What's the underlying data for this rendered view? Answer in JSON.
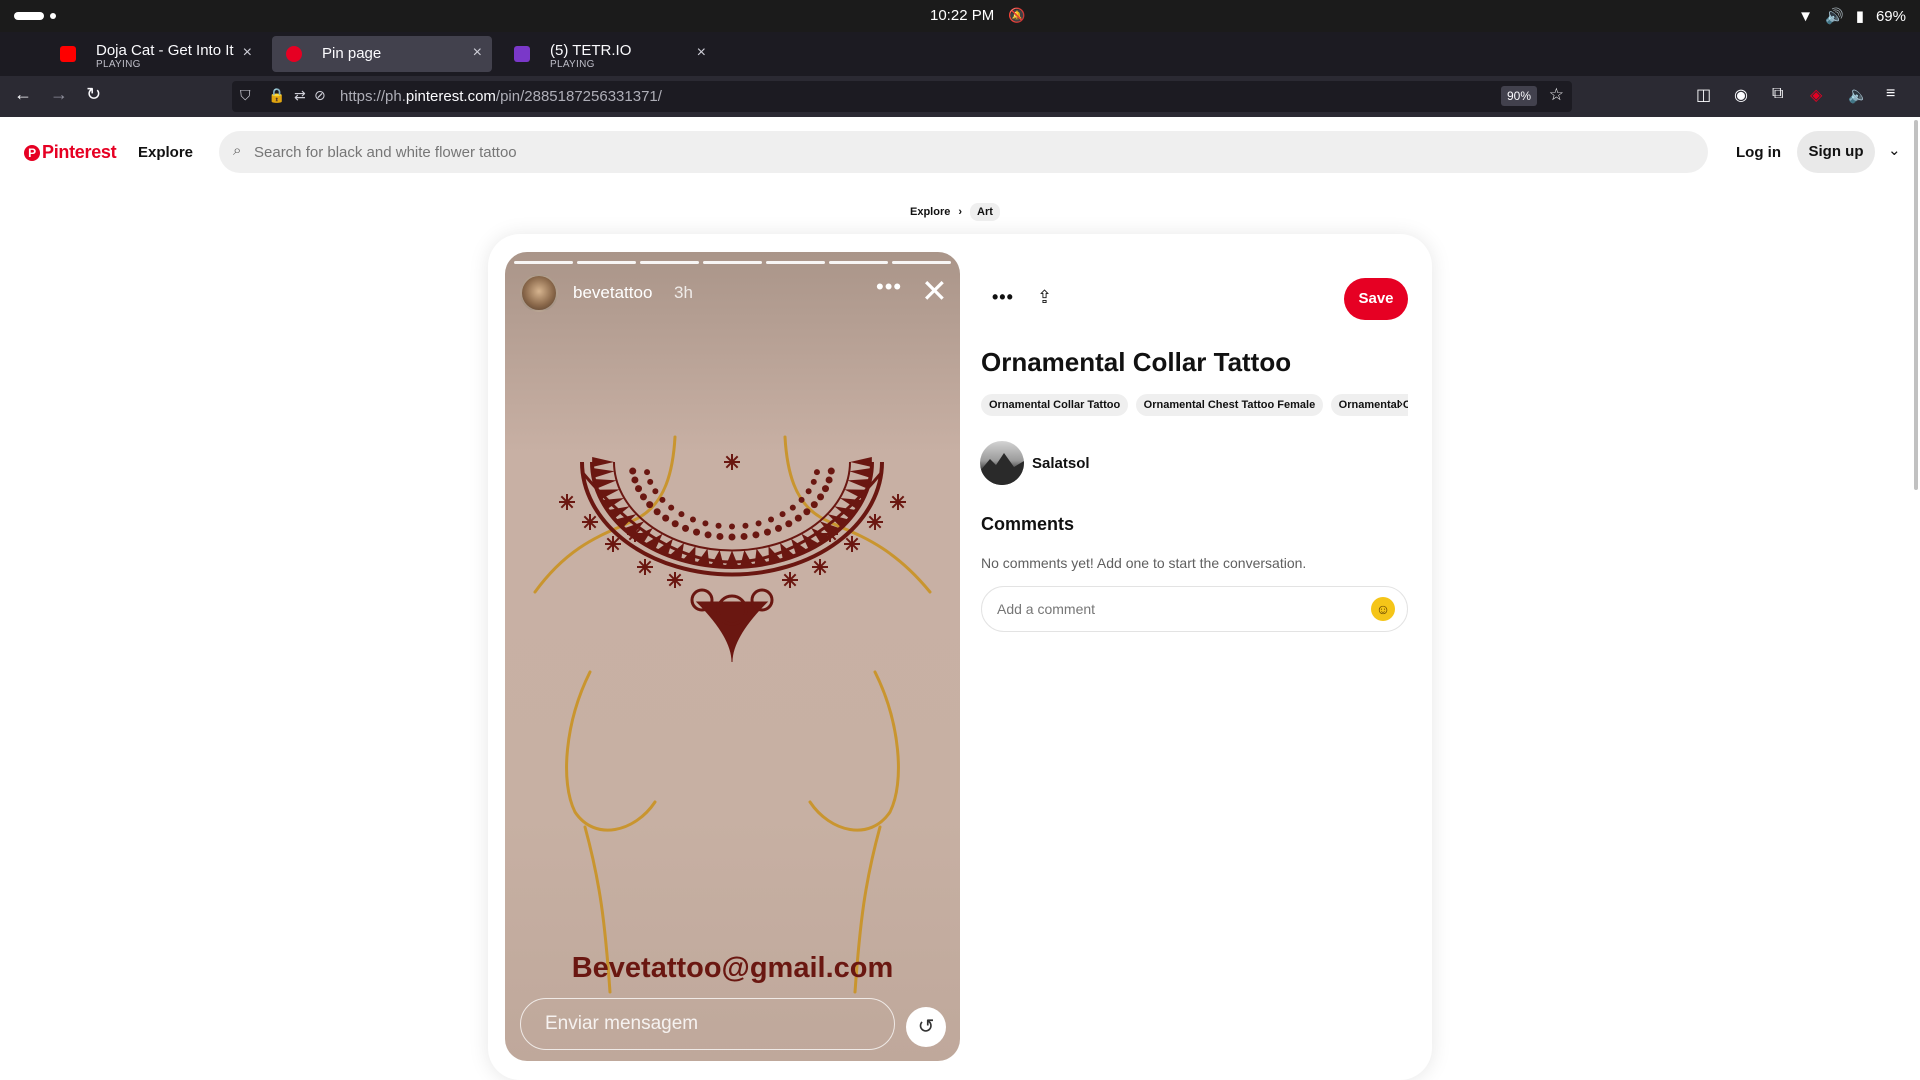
{
  "system": {
    "time": "10:22 PM",
    "battery": "69%"
  },
  "browser": {
    "tabs": [
      {
        "title": "Doja Cat - Get Into It (Yuh",
        "status": "PLAYING",
        "favicon_color": "#ff0000"
      },
      {
        "title": "Pin page",
        "status": "",
        "favicon_color": "#e60023"
      },
      {
        "title": "(5) TETR.IO",
        "status": "PLAYING",
        "favicon_color": "#7a38c9"
      }
    ],
    "url_prefix": "https://ph.",
    "url_domain": "pinterest.com",
    "url_path": "/pin/2885187256331371/",
    "zoom": "90%"
  },
  "header": {
    "logo_text": "Pinterest",
    "explore_label": "Explore",
    "search_placeholder": "Search for black and white flower tattoo",
    "login_label": "Log in",
    "signup_label": "Sign up"
  },
  "breadcrumb": {
    "items": [
      "Explore",
      "Art"
    ]
  },
  "story": {
    "username": "bevetattoo",
    "time": "3h",
    "email": "Bevetattoo@gmail.com",
    "message_placeholder": "Enviar mensagem",
    "progress_segments": 7,
    "progress_filled": 7
  },
  "pin": {
    "save_label": "Save",
    "title": "Ornamental Collar Tattoo",
    "tags": [
      "Ornamental Collar Tattoo",
      "Ornamental Chest Tattoo Female",
      "Ornamental Ch"
    ],
    "author": "Salatsol",
    "comments_title": "Comments",
    "comments_empty": "No comments yet! Add one to start the conversation.",
    "comment_placeholder": "Add a comment"
  },
  "colors": {
    "brand": "#e60023",
    "tattoo_ink": "#6a1711",
    "outline_gold": "#c9952f"
  }
}
